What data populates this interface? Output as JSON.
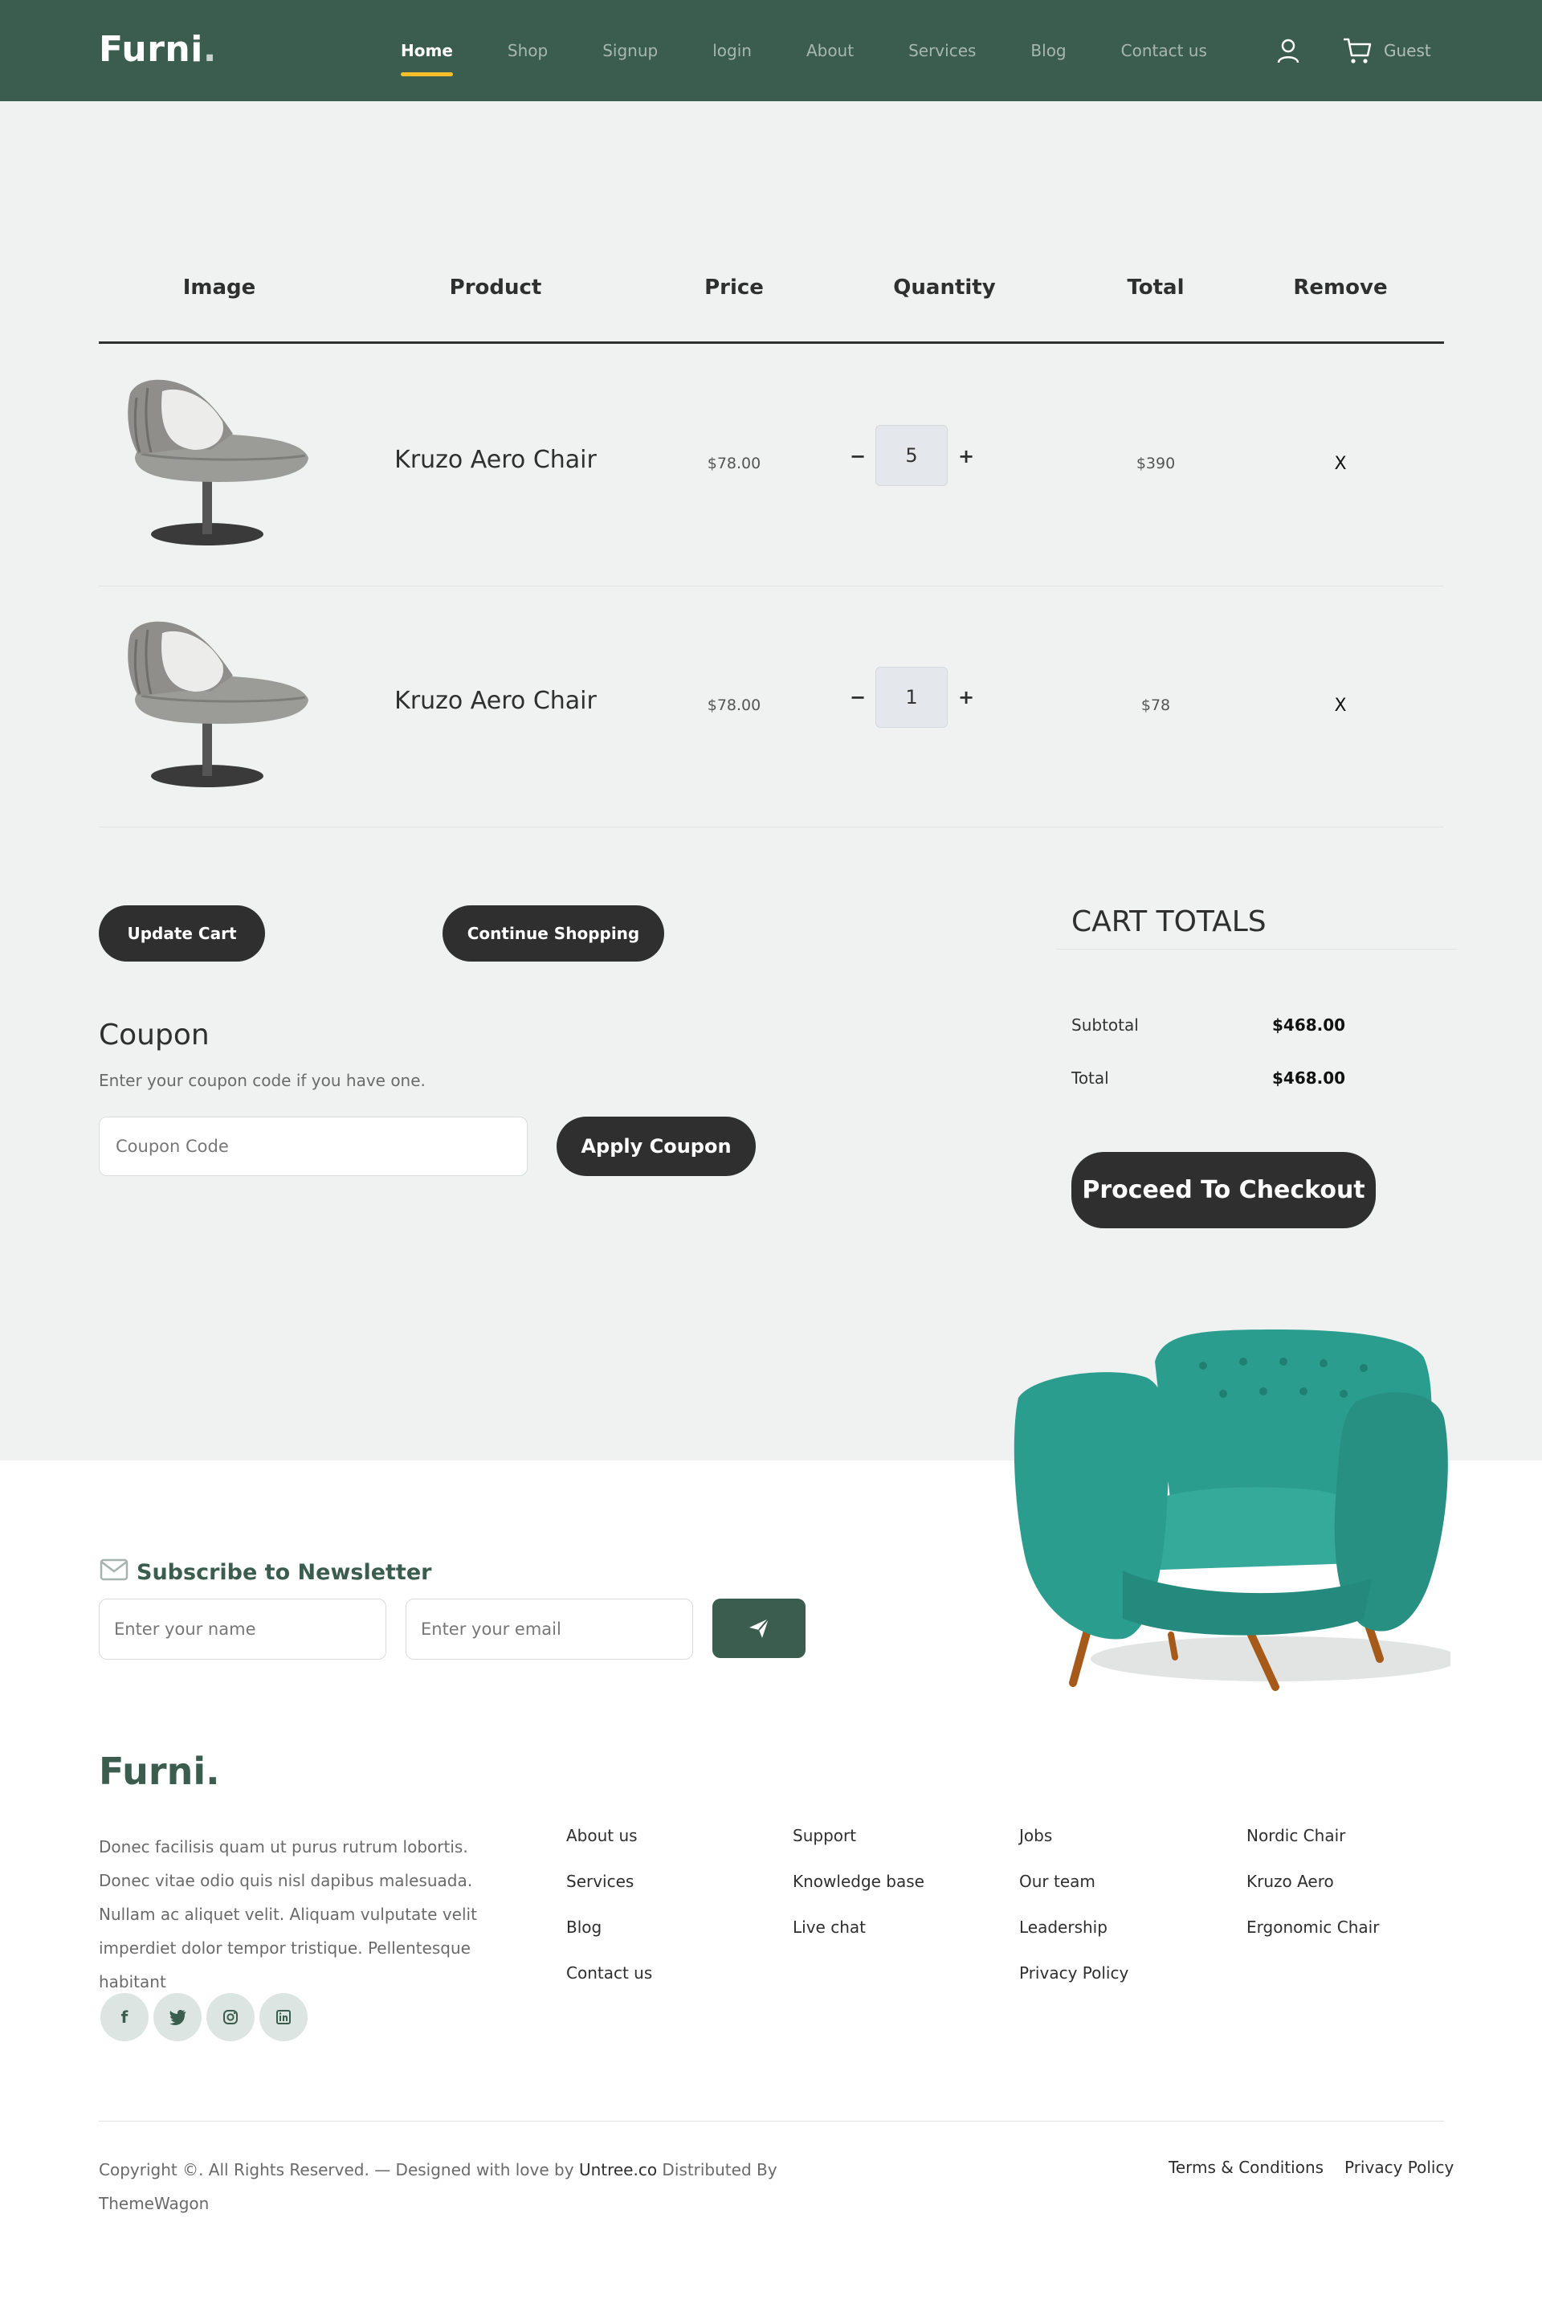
{
  "nav": {
    "brand": "Furni",
    "brand_dot": ".",
    "links": [
      "Home",
      "Shop",
      "Signup",
      "login",
      "About",
      "Services",
      "Blog",
      "Contact us"
    ],
    "active": "Home",
    "user_label": "Guest"
  },
  "cart_table": {
    "headers": [
      "Image",
      "Product",
      "Price",
      "Quantity",
      "Total",
      "Remove"
    ],
    "rows": [
      {
        "product": "Kruzo Aero Chair",
        "price": "$78.00",
        "quantity": "5",
        "total": "$390",
        "remove": "X"
      },
      {
        "product": "Kruzo Aero Chair",
        "price": "$78.00",
        "quantity": "1",
        "total": "$78",
        "remove": "X"
      }
    ],
    "minus": "−",
    "plus": "+"
  },
  "actions": {
    "update_cart": "Update Cart",
    "continue_shopping": "Continue Shopping"
  },
  "coupon": {
    "title": "Coupon",
    "subtitle": "Enter your coupon code if you have one.",
    "placeholder": "Coupon Code",
    "button": "Apply Coupon"
  },
  "totals": {
    "title": "CART TOTALS",
    "subtotal_label": "Subtotal",
    "subtotal_value": "$468.00",
    "total_label": "Total",
    "total_value": "$468.00",
    "checkout": "Proceed To Checkout"
  },
  "newsletter": {
    "title": "Subscribe to Newsletter",
    "name_placeholder": "Enter your name",
    "email_placeholder": "Enter your email"
  },
  "footer": {
    "brand": "Furni.",
    "description": "Donec facilisis quam ut purus rutrum lobortis. Donec vitae odio quis nisl dapibus malesuada. Nullam ac aliquet velit. Aliquam vulputate velit imperdiet dolor tempor tristique. Pellentesque habitant",
    "social_icons": [
      "facebook-icon",
      "twitter-icon",
      "instagram-icon",
      "linkedin-icon"
    ],
    "col1": [
      "About us",
      "Services",
      "Blog",
      "Contact us"
    ],
    "col2": [
      "Support",
      "Knowledge base",
      "Live chat"
    ],
    "col3": [
      "Jobs",
      "Our team",
      "Leadership",
      "Privacy Policy"
    ],
    "col4": [
      "Nordic Chair",
      "Kruzo Aero",
      "Ergonomic Chair"
    ],
    "copyright_prefix": "Copyright ©. All Rights Reserved. — Designed with love by ",
    "copyright_link1": "Untree.co",
    "copyright_mid": " Distributed By ",
    "copyright_link2": "ThemeWagon",
    "terms": "Terms & Conditions",
    "privacy": "Privacy Policy"
  },
  "colors": {
    "primary_green": "#3b5d50",
    "accent_yellow": "#f9bf29",
    "dark_button": "#2f2f2f",
    "page_bg": "#eff2f1",
    "teal_chair": "#2a9d8f"
  }
}
